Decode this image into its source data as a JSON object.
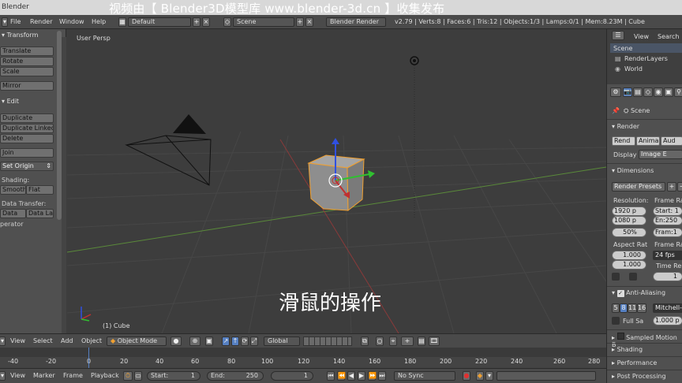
{
  "window": {
    "title": "Blender",
    "watermark": "视频由【 Blender3D模型库 www.blender-3d.cn 】收集发布"
  },
  "topbar": {
    "menus": [
      "File",
      "Render",
      "Window",
      "Help"
    ],
    "layout": "Default",
    "scene": "Scene",
    "engine": "Blender Render",
    "stats": "v2.79 | Verts:8 | Faces:6 | Tris:12 | Objects:1/3 | Lamps:0/1 | Mem:8.23M | Cube"
  },
  "toolshelf": {
    "transform_header": "Transform",
    "translate": "Translate",
    "rotate": "Rotate",
    "scale": "Scale",
    "mirror": "Mirror",
    "edit_header": "Edit",
    "duplicate": "Duplicate",
    "duplicate_linked": "Duplicate Linked",
    "delete": "Delete",
    "join": "Join",
    "set_origin": "Set Origin",
    "shading_label": "Shading:",
    "smooth": "Smooth",
    "flat": "Flat",
    "data_transfer_label": "Data Transfer:",
    "data": "Data",
    "data_layout": "Data La",
    "operator": "perator"
  },
  "viewport": {
    "view_label": "User Persp",
    "object_label": "(1) Cube",
    "subtitle": "滑鼠的操作"
  },
  "view3d_header": {
    "menus": [
      "View",
      "Select",
      "Add",
      "Object"
    ],
    "mode": "Object Mode",
    "orientation": "Global"
  },
  "timeline": {
    "ticks": [
      "-40",
      "-20",
      "0",
      "20",
      "40",
      "60",
      "80",
      "100",
      "120",
      "140",
      "160",
      "180",
      "200",
      "220",
      "240",
      "260",
      "280"
    ],
    "menus": [
      "View",
      "Marker",
      "Frame",
      "Playback"
    ],
    "start_label": "Start:",
    "start_value": "1",
    "end_label": "End:",
    "end_value": "250",
    "current_frame": "1",
    "sync": "No Sync"
  },
  "outliner": {
    "view": "View",
    "search": "Search",
    "items": [
      "Scene",
      "RenderLayers",
      "World"
    ]
  },
  "properties": {
    "scene": "Scene",
    "render_header": "Render",
    "render_btn": "Rend",
    "anim_btn": "Anima",
    "audio_btn": "Aud",
    "display_label": "Display",
    "display_value": "Image E",
    "dimensions_header": "Dimensions",
    "render_presets": "Render Presets",
    "resolution_label": "Resolution:",
    "res_x": "1920 p",
    "res_y": "1080 p",
    "res_pct": "50%",
    "frame_range_label": "Frame Ra",
    "frame_start": "Start: 1",
    "frame_end": "En:250",
    "frame_step": "Fram:1",
    "aspect_label": "Aspect Rat",
    "aspect_x": "1.000",
    "aspect_y": "1.000",
    "frame_rate_label": "Frame Rat",
    "fps": "24 fps",
    "time_remap": "Time Rem",
    "remap_value": "1",
    "aa_header": "Anti-Aliasing",
    "aa_samples": [
      "5",
      "8",
      "11",
      "16"
    ],
    "aa_filter": "Mitchell-",
    "full_sample": "Full Sa",
    "filter_size": "1.000 p",
    "motion_blur": "Sampled Motion B",
    "shading_header": "Shading",
    "performance_header": "Performance",
    "post_processing_header": "Post Processing"
  },
  "colors": {
    "accent_blue": "#5680c2",
    "selected_orange": "#f0a030",
    "axis_red": "#c03030",
    "axis_green": "#30c030",
    "axis_blue": "#3050e0"
  }
}
